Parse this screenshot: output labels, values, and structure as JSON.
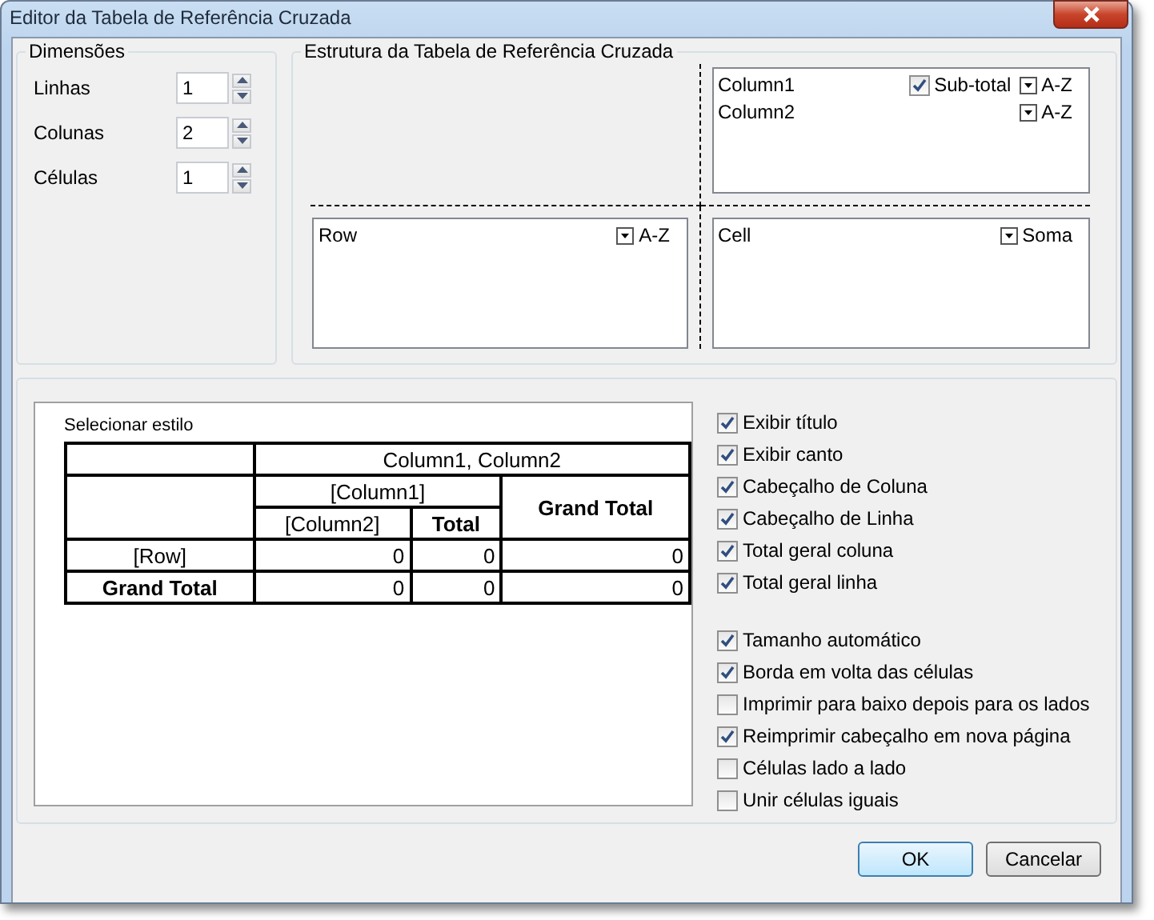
{
  "window": {
    "title": "Editor da Tabela de Referência Cruzada"
  },
  "dimensions": {
    "title": "Dimensões",
    "fields": [
      {
        "label": "Linhas",
        "value": "1"
      },
      {
        "label": "Colunas",
        "value": "2"
      },
      {
        "label": "Células",
        "value": "1"
      }
    ]
  },
  "structure": {
    "title": "Estrutura da Tabela de Referência Cruzada",
    "columns": [
      {
        "name": "Column1",
        "subtotal": {
          "label": "Sub-total",
          "checked": true
        },
        "sort": "A-Z"
      },
      {
        "name": "Column2",
        "sort": "A-Z"
      }
    ],
    "rows": [
      {
        "name": "Row",
        "sort": "A-Z"
      }
    ],
    "cells": [
      {
        "name": "Cell",
        "function": "Soma"
      }
    ]
  },
  "style_preview": {
    "label": "Selecionar estilo",
    "title": "Column1, Column2",
    "column_field": "[Column1]",
    "grand_total_header": "Grand Total",
    "column_subfield": "[Column2]",
    "total_header": "Total",
    "rows": [
      {
        "label": "[Row]",
        "bold": false,
        "values": [
          "0",
          "0",
          "0"
        ]
      },
      {
        "label": "Grand Total",
        "bold": true,
        "values": [
          "0",
          "0",
          "0"
        ]
      }
    ]
  },
  "display_options": [
    {
      "label": "Exibir título",
      "checked": true
    },
    {
      "label": "Exibir canto",
      "checked": true
    },
    {
      "label": "Cabeçalho de Coluna",
      "checked": true
    },
    {
      "label": "Cabeçalho de Linha",
      "checked": true
    },
    {
      "label": "Total geral coluna",
      "checked": true
    },
    {
      "label": "Total geral linha",
      "checked": true
    }
  ],
  "layout_options": [
    {
      "label": "Tamanho automático",
      "checked": true
    },
    {
      "label": "Borda em volta das células",
      "checked": true
    },
    {
      "label": "Imprimir para baixo depois para os lados",
      "checked": false
    },
    {
      "label": "Reimprimir cabeçalho em nova página",
      "checked": true
    },
    {
      "label": "Células lado a lado",
      "checked": false
    },
    {
      "label": "Unir células iguais",
      "checked": false
    }
  ],
  "buttons": [
    {
      "label": "OK",
      "default": true
    },
    {
      "label": "Cancelar",
      "default": false
    }
  ]
}
